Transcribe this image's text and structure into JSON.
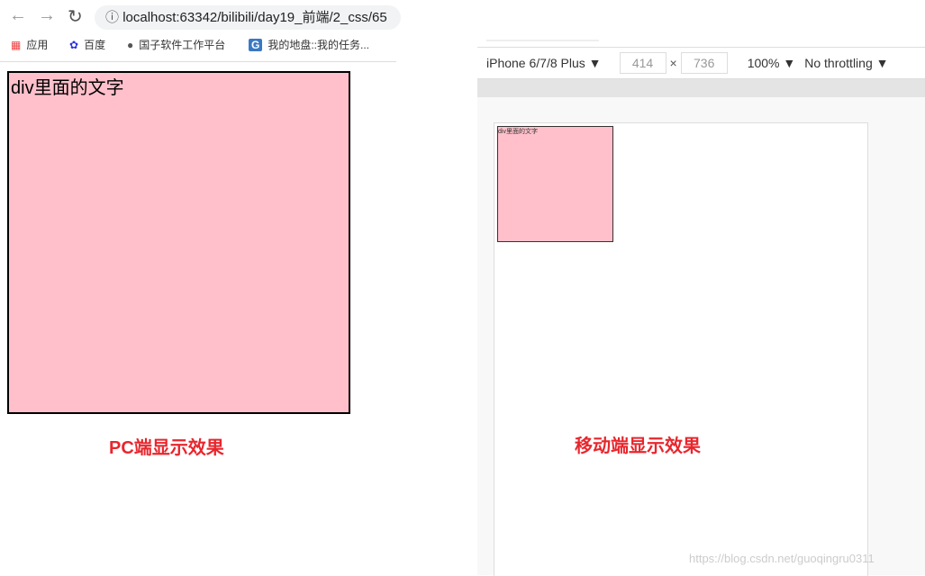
{
  "browser": {
    "url": "localhost:63342/bilibili/day19_前端/2_css/65",
    "bookmarks": [
      {
        "label": "应用",
        "icon": "apps-grid-icon"
      },
      {
        "label": "百度",
        "icon": "baidu-paw-icon"
      },
      {
        "label": "国子软件工作平台",
        "icon": "globe-icon"
      },
      {
        "label": "我的地盘::我的任务...",
        "icon": "g-icon"
      }
    ]
  },
  "pc": {
    "box_text": "div里面的文字",
    "box_color": "#ffc0cb",
    "caption": "PC端显示效果"
  },
  "devtools": {
    "device": "iPhone 6/7/8 Plus ▼",
    "width": "414",
    "times": "×",
    "height": "736",
    "zoom": "100% ▼",
    "throttling": "No throttling ▼"
  },
  "mobile": {
    "box_text": "div里面的文字",
    "caption": "移动端显示效果"
  },
  "watermark": "https://blog.csdn.net/guoqingru0311",
  "colors": {
    "caption": "#e8262d"
  }
}
